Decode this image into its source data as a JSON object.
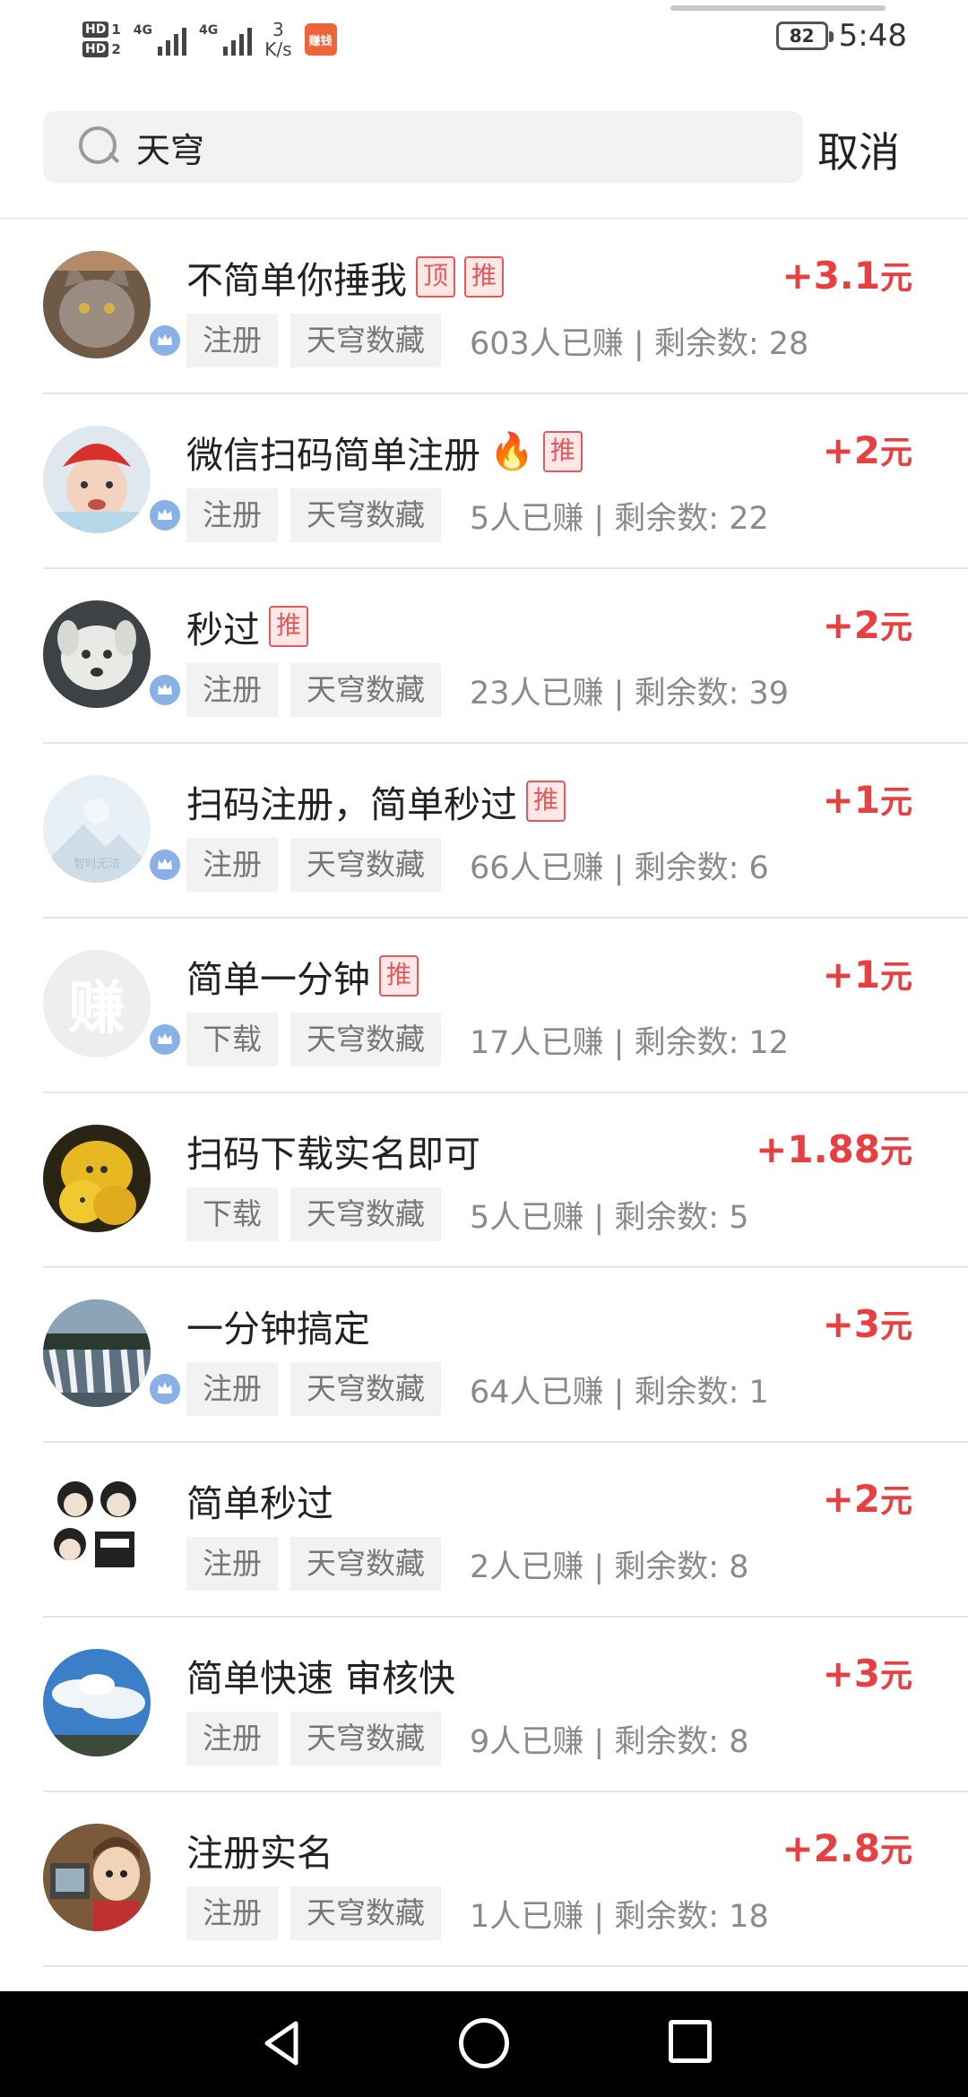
{
  "status_bar": {
    "hd1": "HD",
    "hd1_sim": "1",
    "hd2": "HD",
    "hd2_sim": "2",
    "network1": "4G",
    "network2": "4G",
    "speed_value": "3",
    "speed_unit": "K/s",
    "app_icon_label": "赚钱",
    "battery": "82",
    "time": "5:48"
  },
  "search": {
    "query": "天穹",
    "cancel_label": "取消"
  },
  "colors": {
    "reward": "#e84040",
    "tag_border": "#e25a5a",
    "badge": "#8ab0e8"
  },
  "tasks": [
    {
      "title": "不简单你捶我",
      "tags": [
        "顶",
        "推"
      ],
      "reward": "+3.1",
      "unit": "元",
      "type": "注册",
      "platform": "天穹数藏",
      "stats": "603人已赚 | 剩余数: 28",
      "avatar": "cat",
      "verified": true
    },
    {
      "title": "微信扫码简单注册",
      "fire": true,
      "tags": [
        "推"
      ],
      "reward": "+2",
      "unit": "元",
      "type": "注册",
      "platform": "天穹数藏",
      "stats": "5人已赚 | 剩余数: 22",
      "avatar": "baby",
      "verified": true
    },
    {
      "title": "秒过",
      "tags": [
        "推"
      ],
      "reward": "+2",
      "unit": "元",
      "type": "注册",
      "platform": "天穹数藏",
      "stats": "23人已赚 | 剩余数: 39",
      "avatar": "dog",
      "verified": true
    },
    {
      "title": "扫码注册，简单秒过",
      "tags": [
        "推"
      ],
      "reward": "+1",
      "unit": "元",
      "type": "注册",
      "platform": "天穹数藏",
      "stats": "66人已赚 | 剩余数: 6",
      "avatar": "placeholder",
      "avatar_text": "智时无法",
      "verified": true
    },
    {
      "title": "简单一分钟",
      "tags": [
        "推"
      ],
      "reward": "+1",
      "unit": "元",
      "type": "下载",
      "platform": "天穹数藏",
      "stats": "17人已赚 | 剩余数: 12",
      "avatar": "text",
      "avatar_text": "赚",
      "verified": true
    },
    {
      "title": "扫码下载实名即可",
      "tags": [],
      "reward": "+1.88",
      "unit": "元",
      "type": "下载",
      "platform": "天穹数藏",
      "stats": "5人已赚 | 剩余数: 5",
      "avatar": "fruit",
      "verified": false
    },
    {
      "title": "一分钟搞定",
      "tags": [],
      "reward": "+3",
      "unit": "元",
      "type": "注册",
      "platform": "天穹数藏",
      "stats": "64人已赚 | 剩余数: 1",
      "avatar": "waterfall",
      "verified": true
    },
    {
      "title": "简单秒过",
      "tags": [],
      "reward": "+2",
      "unit": "元",
      "type": "注册",
      "platform": "天穹数藏",
      "stats": "2人已赚 | 剩余数: 8",
      "avatar": "meme",
      "verified": false
    },
    {
      "title": "简单快速  审核快",
      "tags": [],
      "reward": "+3",
      "unit": "元",
      "type": "注册",
      "platform": "天穹数藏",
      "stats": "9人已赚 | 剩余数: 8",
      "avatar": "sky",
      "verified": false
    },
    {
      "title": "注册实名",
      "tags": [],
      "reward": "+2.8",
      "unit": "元",
      "type": "注册",
      "platform": "天穹数藏",
      "stats": "1人已赚 | 剩余数: 18",
      "avatar": "cartoon",
      "verified": false
    }
  ],
  "nav": {
    "back": "back-icon",
    "home": "home-icon",
    "recent": "recent-apps-icon"
  }
}
